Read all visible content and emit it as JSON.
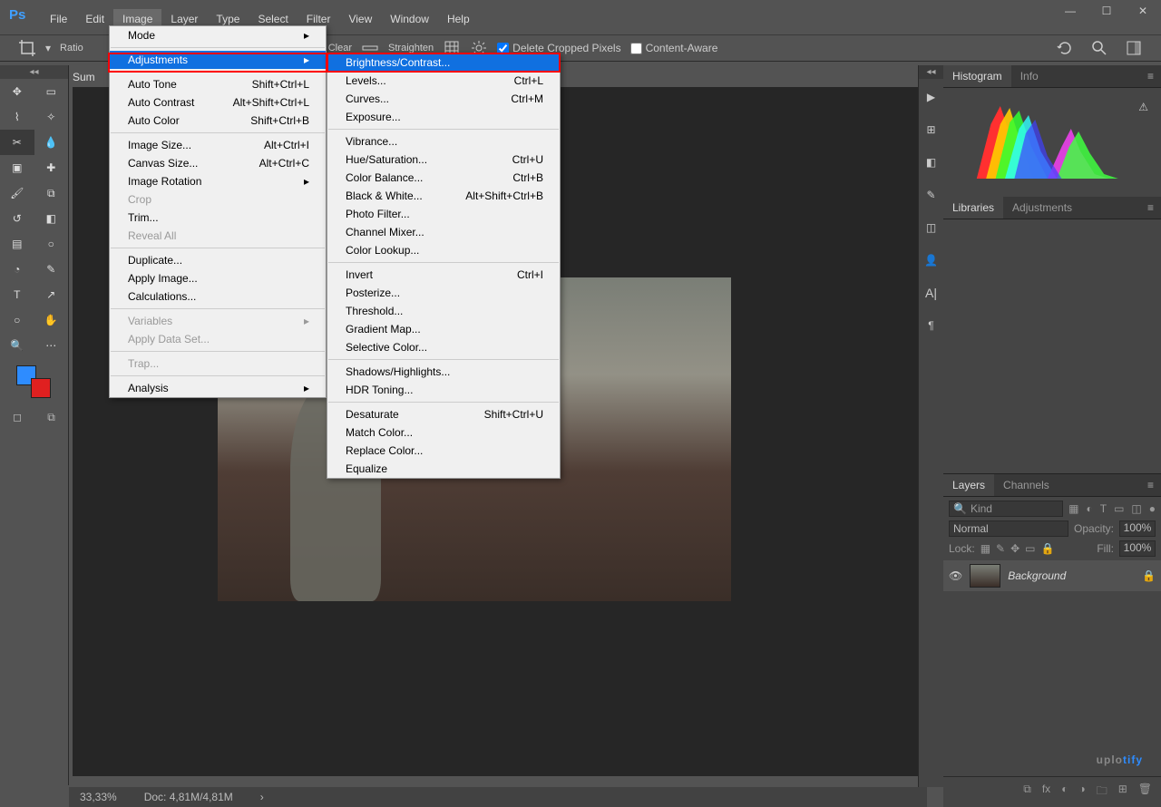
{
  "app": {
    "logo": "Ps"
  },
  "window_controls": {
    "min": "—",
    "max": "☐",
    "close": "✕"
  },
  "menubar": [
    "File",
    "Edit",
    "Image",
    "Layer",
    "Type",
    "Select",
    "Filter",
    "View",
    "Window",
    "Help"
  ],
  "menubar_active_index": 2,
  "image_menu": {
    "items": [
      {
        "label": "Mode",
        "arrow": true
      },
      {
        "sep": true
      },
      {
        "label": "Adjustments",
        "arrow": true,
        "highlight": true
      },
      {
        "sep": true
      },
      {
        "label": "Auto Tone",
        "shortcut": "Shift+Ctrl+L"
      },
      {
        "label": "Auto Contrast",
        "shortcut": "Alt+Shift+Ctrl+L"
      },
      {
        "label": "Auto Color",
        "shortcut": "Shift+Ctrl+B"
      },
      {
        "sep": true
      },
      {
        "label": "Image Size...",
        "shortcut": "Alt+Ctrl+I"
      },
      {
        "label": "Canvas Size...",
        "shortcut": "Alt+Ctrl+C"
      },
      {
        "label": "Image Rotation",
        "arrow": true
      },
      {
        "label": "Crop",
        "disabled": true
      },
      {
        "label": "Trim..."
      },
      {
        "label": "Reveal All",
        "disabled": true
      },
      {
        "sep": true
      },
      {
        "label": "Duplicate..."
      },
      {
        "label": "Apply Image..."
      },
      {
        "label": "Calculations..."
      },
      {
        "sep": true
      },
      {
        "label": "Variables",
        "arrow": true,
        "disabled": true
      },
      {
        "label": "Apply Data Set...",
        "disabled": true
      },
      {
        "sep": true
      },
      {
        "label": "Trap...",
        "disabled": true
      },
      {
        "sep": true
      },
      {
        "label": "Analysis",
        "arrow": true
      }
    ]
  },
  "adjustments_menu": {
    "items": [
      {
        "label": "Brightness/Contrast...",
        "highlight": true
      },
      {
        "label": "Levels...",
        "shortcut": "Ctrl+L"
      },
      {
        "label": "Curves...",
        "shortcut": "Ctrl+M"
      },
      {
        "label": "Exposure..."
      },
      {
        "sep": true
      },
      {
        "label": "Vibrance..."
      },
      {
        "label": "Hue/Saturation...",
        "shortcut": "Ctrl+U"
      },
      {
        "label": "Color Balance...",
        "shortcut": "Ctrl+B"
      },
      {
        "label": "Black & White...",
        "shortcut": "Alt+Shift+Ctrl+B"
      },
      {
        "label": "Photo Filter..."
      },
      {
        "label": "Channel Mixer..."
      },
      {
        "label": "Color Lookup..."
      },
      {
        "sep": true
      },
      {
        "label": "Invert",
        "shortcut": "Ctrl+I"
      },
      {
        "label": "Posterize..."
      },
      {
        "label": "Threshold..."
      },
      {
        "label": "Gradient Map..."
      },
      {
        "label": "Selective Color..."
      },
      {
        "sep": true
      },
      {
        "label": "Shadows/Highlights..."
      },
      {
        "label": "HDR Toning..."
      },
      {
        "sep": true
      },
      {
        "label": "Desaturate",
        "shortcut": "Shift+Ctrl+U"
      },
      {
        "label": "Match Color..."
      },
      {
        "label": "Replace Color..."
      },
      {
        "label": "Equalize"
      }
    ]
  },
  "options_bar": {
    "ratio_label": "Ratio",
    "clear": "Clear",
    "straighten": "Straighten",
    "delete_cropped": "Delete Cropped Pixels",
    "content_aware": "Content-Aware"
  },
  "doc_tab": "Sum",
  "tools": {
    "left": [
      "move",
      "marquee",
      "lasso",
      "wand",
      "crop",
      "eyedrop",
      "frame",
      "heal",
      "brush",
      "stamp",
      "history",
      "eraser",
      "gradient",
      "blur",
      "dodge",
      "pen",
      "type",
      "path",
      "rect",
      "hand",
      "zoom",
      "more"
    ],
    "active": "crop"
  },
  "right_panels": {
    "histogram_tabs": [
      "Histogram",
      "Info"
    ],
    "libraries_tabs": [
      "Libraries",
      "Adjustments"
    ],
    "layers_tabs": [
      "Layers",
      "Channels"
    ],
    "kind_placeholder": "Kind",
    "blend_mode": "Normal",
    "opacity_label": "Opacity:",
    "opacity_value": "100%",
    "lock_label": "Lock:",
    "fill_label": "Fill:",
    "fill_value": "100%",
    "layer_name": "Background"
  },
  "dock_icons": [
    "play",
    "char",
    "color",
    "brush",
    "swap",
    "layers",
    "type",
    "para"
  ],
  "status": {
    "zoom": "33,33%",
    "doc": "Doc: 4,81M/4,81M"
  },
  "watermark": {
    "a": "uplo",
    "b": "tify"
  }
}
